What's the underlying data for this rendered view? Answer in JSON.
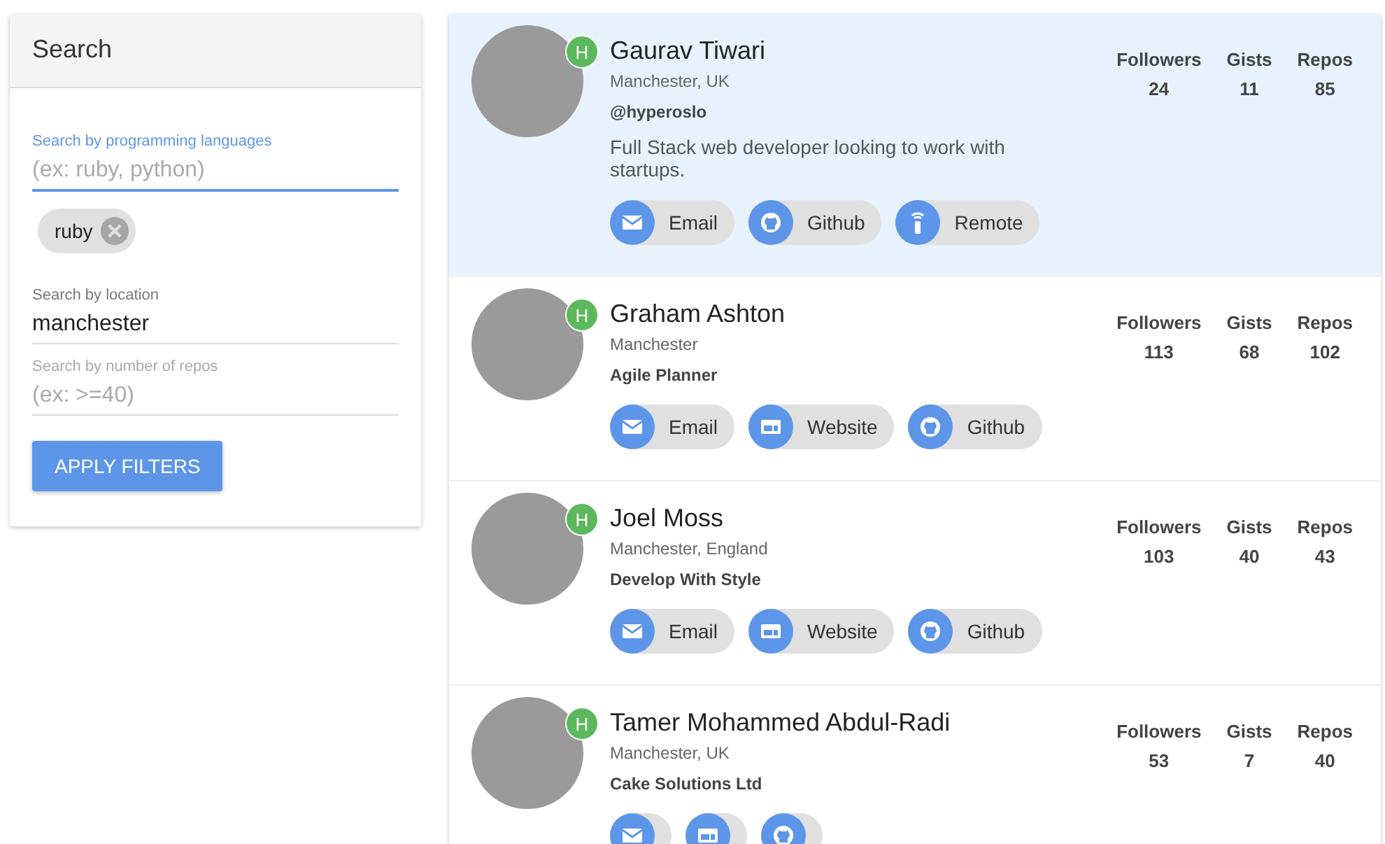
{
  "search_panel": {
    "title": "Search",
    "fields": [
      {
        "label": "Search by programming languages",
        "placeholder": "(ex: ruby, python)",
        "focused": true,
        "chips": [
          "ruby"
        ]
      },
      {
        "label": "Search by location",
        "value": "manchester",
        "focused": false
      },
      {
        "label": "Search by number of repos",
        "placeholder": "(ex: >=40)",
        "focused": false
      }
    ],
    "button": "APPLY FILTERS"
  },
  "users": [
    {
      "name": "Gaurav Tiwari",
      "badge": "H",
      "location": "Manchester, UK",
      "company": "@hyperoslo",
      "bio": "Full Stack web developer looking to work with startups.",
      "selected": true,
      "stats": [
        {
          "label": "Followers",
          "value": "24"
        },
        {
          "label": "Gists",
          "value": "11"
        },
        {
          "label": "Repos",
          "value": "85"
        }
      ],
      "links": [
        {
          "kind": "email",
          "label": "Email"
        },
        {
          "kind": "github",
          "label": "Github"
        },
        {
          "kind": "remote",
          "label": "Remote"
        }
      ]
    },
    {
      "name": "Graham Ashton",
      "badge": "H",
      "location": "Manchester",
      "company": "Agile Planner",
      "selected": false,
      "stats": [
        {
          "label": "Followers",
          "value": "113"
        },
        {
          "label": "Gists",
          "value": "68"
        },
        {
          "label": "Repos",
          "value": "102"
        }
      ],
      "links": [
        {
          "kind": "email",
          "label": "Email"
        },
        {
          "kind": "website",
          "label": "Website"
        },
        {
          "kind": "github",
          "label": "Github"
        }
      ]
    },
    {
      "name": "Joel Moss",
      "badge": "H",
      "location": "Manchester, England",
      "company": "Develop With Style",
      "selected": false,
      "stats": [
        {
          "label": "Followers",
          "value": "103"
        },
        {
          "label": "Gists",
          "value": "40"
        },
        {
          "label": "Repos",
          "value": "43"
        }
      ],
      "links": [
        {
          "kind": "email",
          "label": "Email"
        },
        {
          "kind": "website",
          "label": "Website"
        },
        {
          "kind": "github",
          "label": "Github"
        }
      ]
    },
    {
      "name": "Tamer Mohammed Abdul-Radi",
      "badge": "H",
      "location": "Manchester, UK",
      "company": "Cake Solutions Ltd",
      "selected": false,
      "stats": [
        {
          "label": "Followers",
          "value": "53"
        },
        {
          "label": "Gists",
          "value": "7"
        },
        {
          "label": "Repos",
          "value": "40"
        }
      ],
      "links": [
        {
          "kind": "email"
        },
        {
          "kind": "website"
        },
        {
          "kind": "github"
        }
      ]
    }
  ]
}
